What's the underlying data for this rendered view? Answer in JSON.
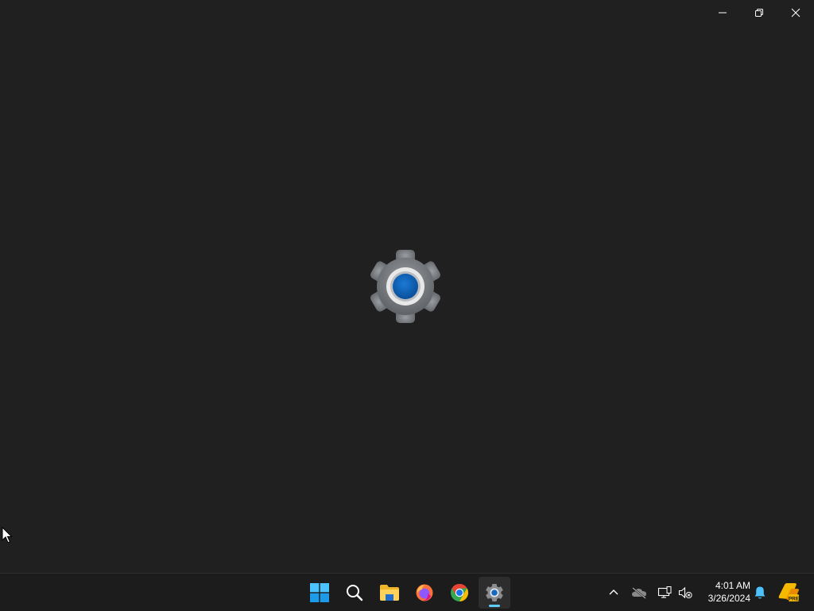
{
  "window": {
    "controls": {
      "minimize": "minimize-icon",
      "maximize": "restore-icon",
      "close": "close-icon"
    },
    "splash_icon": "settings-gear-icon"
  },
  "taskbar": {
    "apps": [
      {
        "name": "start",
        "icon": "windows-logo-icon"
      },
      {
        "name": "search",
        "icon": "search-icon"
      },
      {
        "name": "file-explorer",
        "icon": "folder-icon"
      },
      {
        "name": "firefox",
        "icon": "firefox-icon"
      },
      {
        "name": "chrome",
        "icon": "chrome-icon"
      },
      {
        "name": "settings",
        "icon": "settings-gear-icon",
        "active": true
      }
    ],
    "tray": {
      "icons": [
        "chevron-up-icon",
        "onedrive-icon",
        "network-icon",
        "volume-muted-icon",
        "bell-icon",
        "pre-badge-icon"
      ],
      "pre_badge": "PRE",
      "time": "4:01 AM",
      "date": "3/26/2024"
    }
  },
  "colors": {
    "background": "#202020",
    "taskbar": "#1c1c1c",
    "accent": "#60cdff",
    "gear_gray": "#7a7d82",
    "gear_center": "#0f5fb3"
  }
}
